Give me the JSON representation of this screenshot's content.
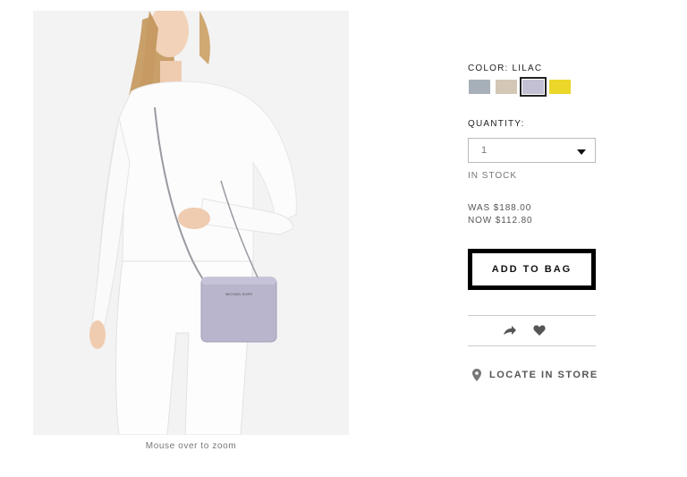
{
  "product": {
    "zoom_hint": "Mouse over to zoom",
    "bag_brand_text": "MICHAEL KORS"
  },
  "color": {
    "label": "COLOR: LILAC",
    "swatches": [
      {
        "name": "grey-blue",
        "hex": "#a7b0b8",
        "selected": false
      },
      {
        "name": "beige",
        "hex": "#d4c7b6",
        "selected": false
      },
      {
        "name": "lilac",
        "hex": "#c3c0d4",
        "selected": true
      },
      {
        "name": "yellow",
        "hex": "#ebd62a",
        "selected": false
      }
    ]
  },
  "quantity": {
    "label": "QUANTITY:",
    "value": "1",
    "stock_status": "IN STOCK"
  },
  "price": {
    "was": "WAS $188.00",
    "now": "NOW $112.80"
  },
  "actions": {
    "add_to_bag": "ADD TO BAG",
    "share_icon": "share-arrow-icon",
    "favorite_icon": "heart-icon"
  },
  "store": {
    "locate_label": "LOCATE IN STORE",
    "icon": "map-pin-icon"
  }
}
